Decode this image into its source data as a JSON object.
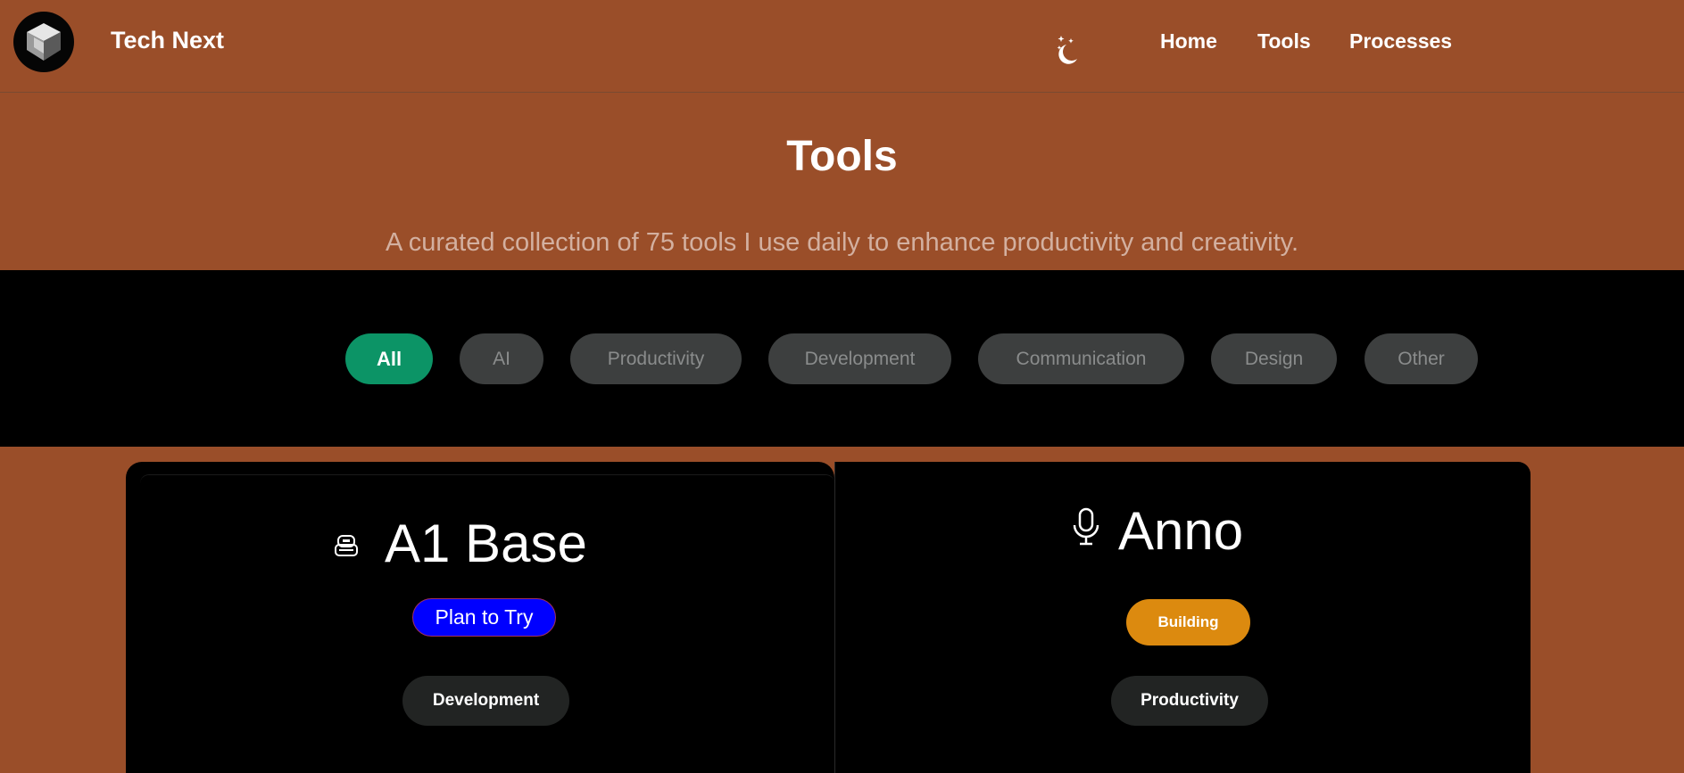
{
  "header": {
    "brand": "Tech Next",
    "logo_icon": "cube-logo-icon",
    "theme_icon": "moon-stars-icon",
    "nav": [
      {
        "label": "Home"
      },
      {
        "label": "Tools"
      },
      {
        "label": "Processes"
      }
    ]
  },
  "hero": {
    "title": "Tools",
    "subtitle": "A curated collection of 75 tools I use daily to enhance productivity and creativity."
  },
  "filters": {
    "active": "All",
    "items": [
      "All",
      "AI",
      "Productivity",
      "Development",
      "Communication",
      "Design",
      "Other"
    ]
  },
  "tools": [
    {
      "name": "A1 Base",
      "icon": "robot-icon",
      "status": "Plan to Try",
      "category": "Development"
    },
    {
      "name": "Anno",
      "icon": "microphone-icon",
      "status": "Building",
      "category": "Productivity"
    }
  ],
  "colors": {
    "background": "#9a4e29",
    "active_filter": "#0c9466",
    "plan_to_try": "#0000ff",
    "building": "#dc8a0f"
  }
}
